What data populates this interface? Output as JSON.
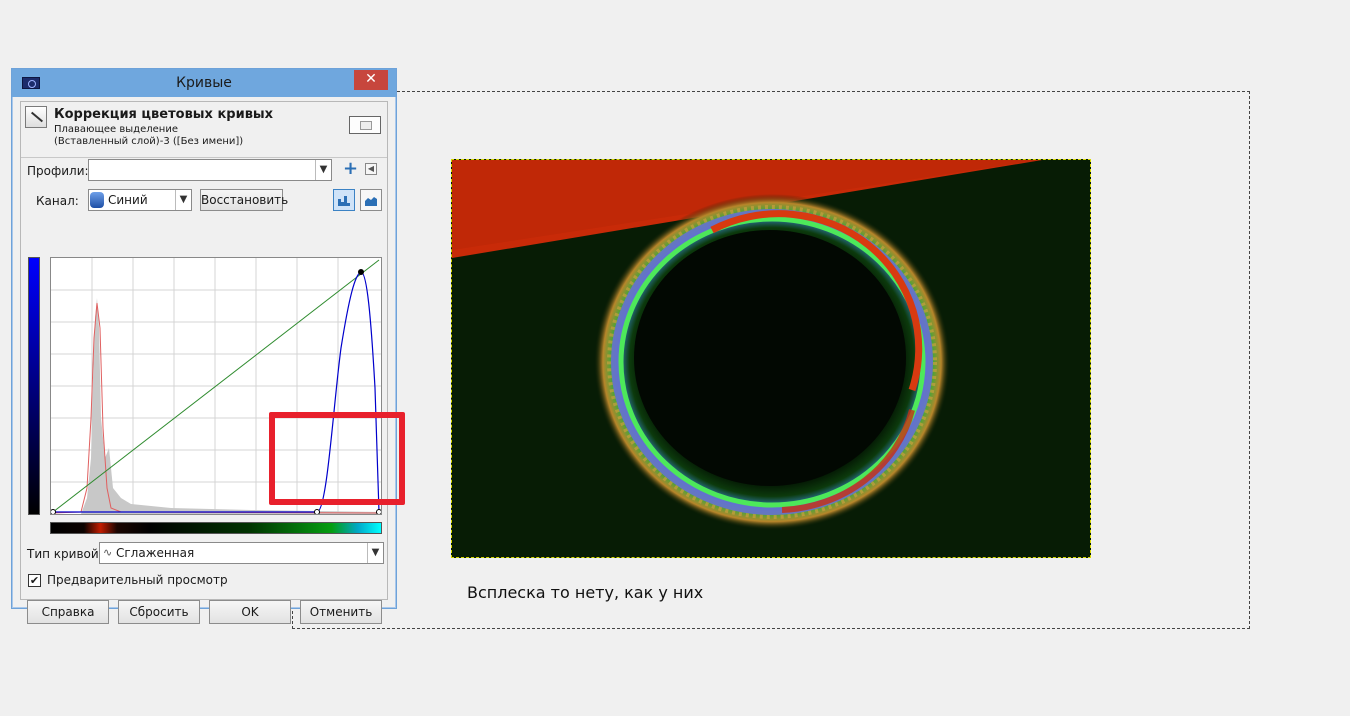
{
  "dialog": {
    "title": "Кривые",
    "close_symbol": "✕",
    "header": {
      "title": "Коррекция цветовых кривых",
      "subtitle1": "Плавающее выделение",
      "subtitle2": "(Вставленный слой)-3 ([Без имени])"
    },
    "profiles_label": "Профили:",
    "profiles_value": "",
    "channel_label": "Канал:",
    "channel_value": "Синий",
    "reset_channel_button": "Восстановить",
    "curve_type_label": "Тип кривой:",
    "curve_type_value": "Сглаженная",
    "preview_label": "Предварительный просмотр",
    "preview_checked": true,
    "buttons": {
      "help": "Справка",
      "reset": "Сбросить",
      "ok": "OK",
      "cancel": "Отменить"
    }
  },
  "caption": "Всплеска то нету, как у них",
  "colors": {
    "titlebar": "#6fa7de",
    "highlight": "#e8202c",
    "blue_curve": "#0000cc",
    "value_line": "#2e8b2e",
    "red_histogram": "#e06060"
  }
}
